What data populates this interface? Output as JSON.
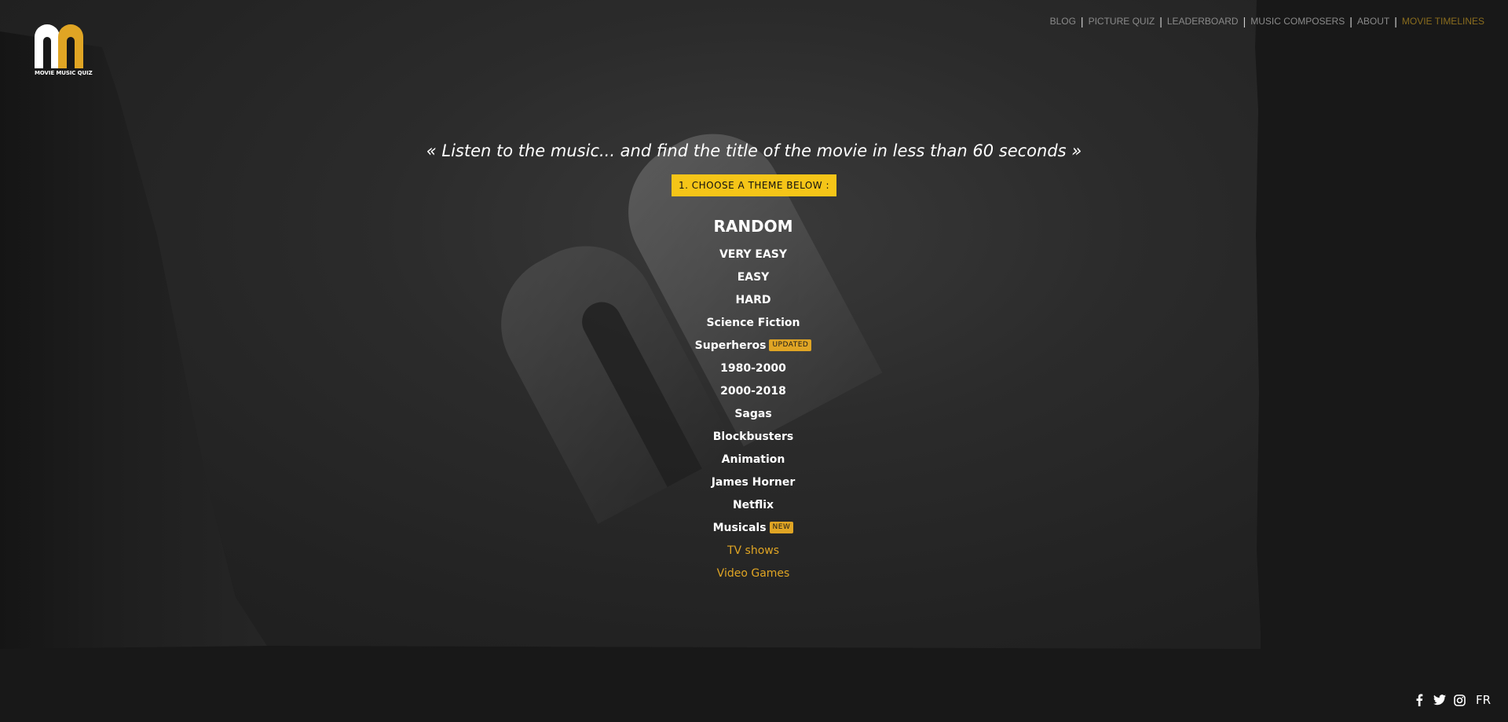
{
  "logo": {
    "text": "MOVIE MUSIC QUIZ",
    "colors": {
      "left": "#ffffff",
      "right": "#e0a524"
    }
  },
  "nav": {
    "items": [
      {
        "label": "BLOG"
      },
      {
        "label": "PICTURE QUIZ"
      },
      {
        "label": "LEADERBOARD"
      },
      {
        "label": "MUSIC COMPOSERS"
      },
      {
        "label": "ABOUT"
      },
      {
        "label": "MOVIE TIMELINES"
      }
    ]
  },
  "main": {
    "tagline": "« Listen to the music... and find the title of the movie in less than 60 seconds »",
    "choose_label": "1. CHOOSE A THEME BELOW :",
    "random_label": "RANDOM",
    "themes": [
      {
        "label": "VERY EASY"
      },
      {
        "label": "EASY"
      },
      {
        "label": "HARD"
      },
      {
        "label": "Science Fiction"
      },
      {
        "label": "Superheros",
        "badge": "UPDATED"
      },
      {
        "label": "1980-2000"
      },
      {
        "label": "2000-2018"
      },
      {
        "label": "Sagas"
      },
      {
        "label": "Blockbusters"
      },
      {
        "label": "Animation"
      },
      {
        "label": "James Horner"
      },
      {
        "label": "Netflix"
      },
      {
        "label": "Musicals",
        "badge": "NEW"
      },
      {
        "label": "TV shows"
      },
      {
        "label": "Video Games"
      }
    ]
  },
  "footer": {
    "icons": [
      "facebook-icon",
      "twitter-icon",
      "instagram-icon"
    ],
    "language": "FR"
  },
  "colors": {
    "accent": "#f5c518",
    "gold": "#e0a524",
    "nav_text": "#8a8a8a",
    "background": "#181818"
  }
}
